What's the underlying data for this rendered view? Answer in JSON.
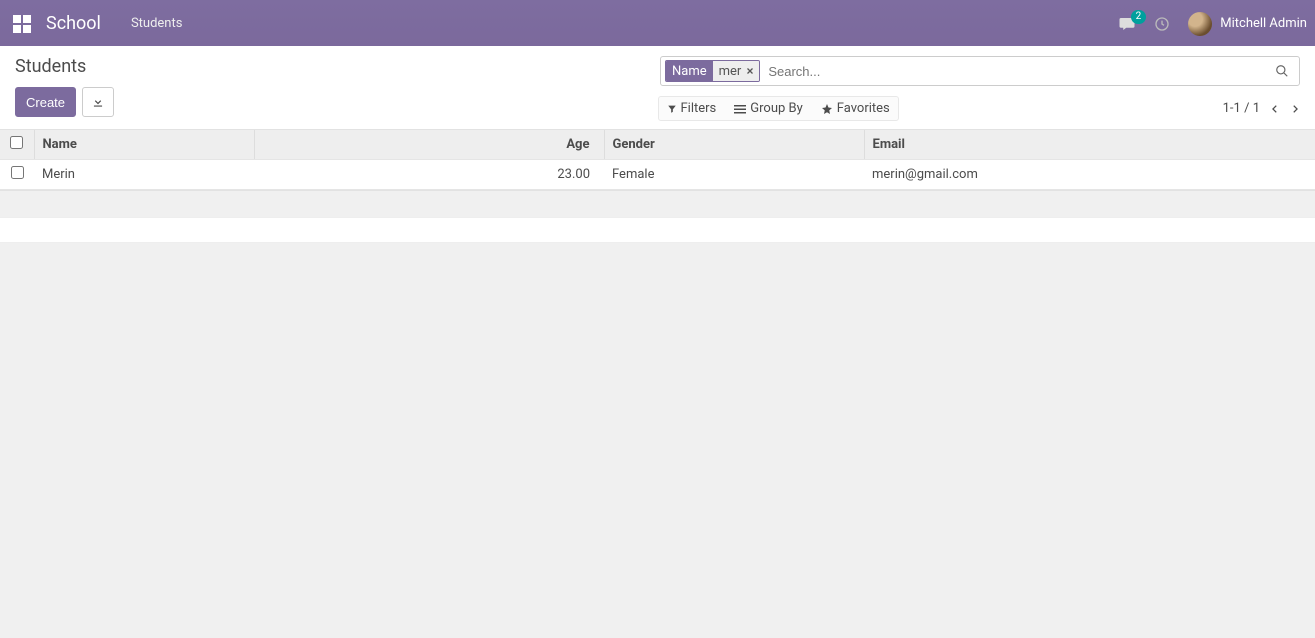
{
  "navbar": {
    "brand": "School",
    "menu": "Students",
    "badge_count": "2",
    "user_name": "Mitchell Admin"
  },
  "breadcrumb": {
    "title": "Students"
  },
  "toolbar": {
    "create_label": "Create"
  },
  "search": {
    "facet_label": "Name",
    "facet_value": "mer",
    "placeholder": "Search..."
  },
  "search_options": {
    "filters": "Filters",
    "group_by": "Group By",
    "favorites": "Favorites"
  },
  "pager": {
    "range": "1-1",
    "separator": "/",
    "total": "1"
  },
  "table": {
    "headers": {
      "name": "Name",
      "age": "Age",
      "gender": "Gender",
      "email": "Email"
    },
    "rows": [
      {
        "name": "Merin",
        "age": "23.00",
        "gender": "Female",
        "email": "merin@gmail.com"
      }
    ]
  }
}
